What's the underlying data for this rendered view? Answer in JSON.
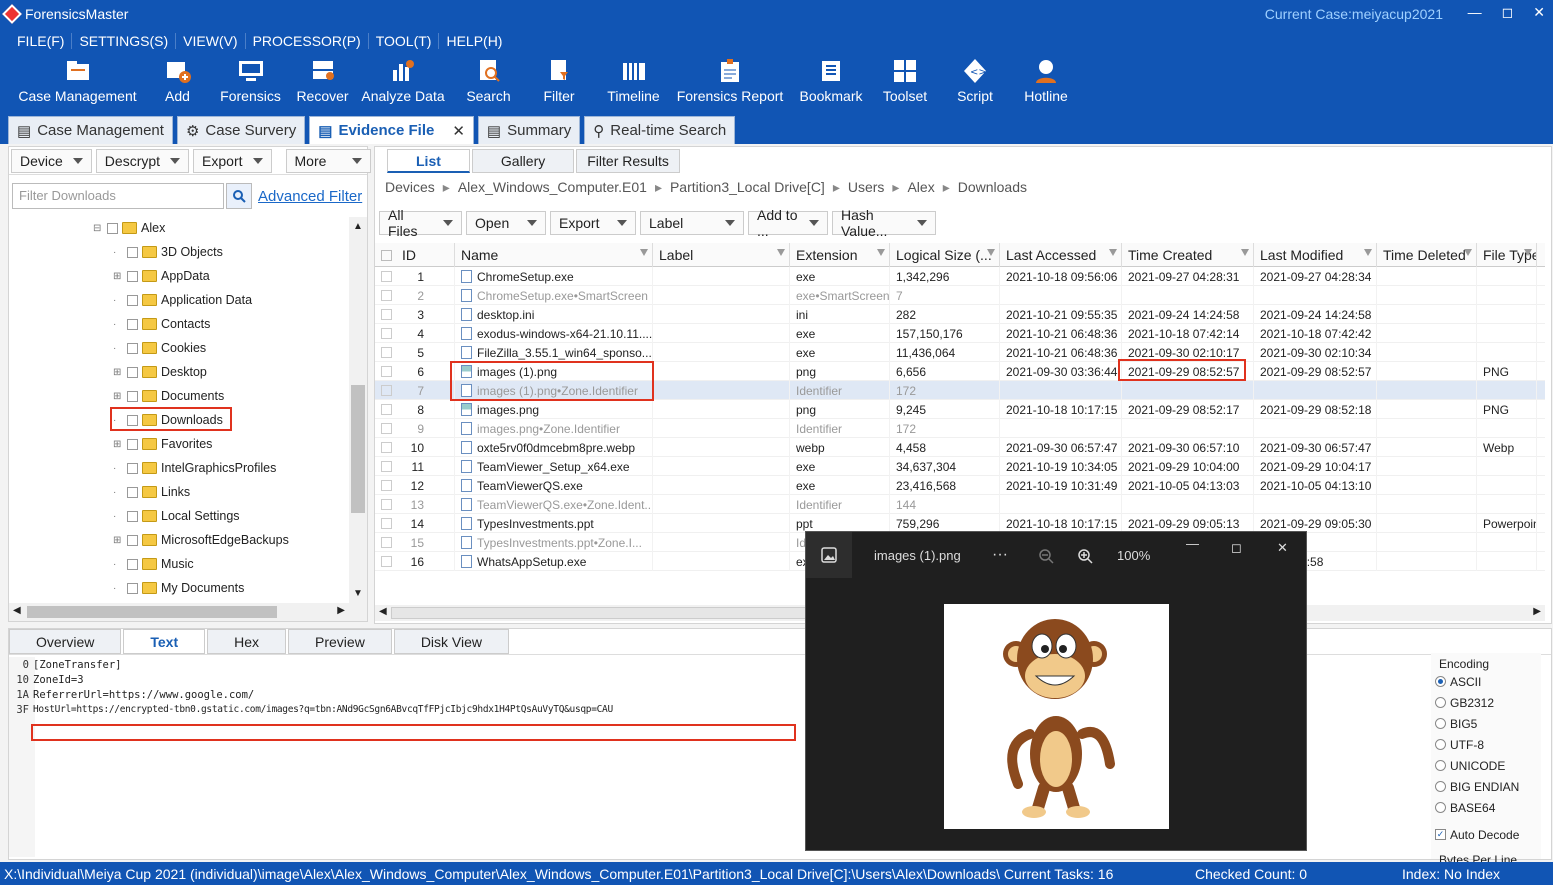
{
  "app": {
    "title": "ForensicsMaster",
    "current_case": "Current Case:meiyacup2021"
  },
  "menu": [
    "FILE(F)",
    "SETTINGS(S)",
    "VIEW(V)",
    "PROCESSOR(P)",
    "TOOL(T)",
    "HELP(H)"
  ],
  "toolbar": [
    {
      "label": "Case Management",
      "icon": "case-management-icon"
    },
    {
      "label": "Add",
      "icon": "add-icon"
    },
    {
      "label": "Forensics",
      "icon": "forensics-icon"
    },
    {
      "label": "Recover",
      "icon": "recover-icon"
    },
    {
      "label": "Analyze Data",
      "icon": "analyze-icon"
    },
    {
      "label": "Search",
      "icon": "search-icon"
    },
    {
      "label": "Filter",
      "icon": "filter-icon"
    },
    {
      "label": "Timeline",
      "icon": "timeline-icon"
    },
    {
      "label": "Forensics Report",
      "icon": "report-icon"
    },
    {
      "label": "Bookmark",
      "icon": "bookmark-icon"
    },
    {
      "label": "Toolset",
      "icon": "toolset-icon"
    },
    {
      "label": "Script",
      "icon": "script-icon"
    },
    {
      "label": "Hotline",
      "icon": "hotline-icon"
    }
  ],
  "doc_tabs": [
    "Case Management",
    "Case Survery",
    "Evidence File",
    "Summary",
    "Real-time Search"
  ],
  "left": {
    "dropdowns": [
      "Device",
      "Descrypt",
      "Export",
      "More"
    ],
    "filter_placeholder": "Filter Downloads",
    "advanced_filter": "Advanced Filter",
    "tree": [
      "Alex",
      "3D Objects",
      "AppData",
      "Application Data",
      "Contacts",
      "Cookies",
      "Desktop",
      "Documents",
      "Downloads",
      "Favorites",
      "IntelGraphicsProfiles",
      "Links",
      "Local Settings",
      "MicrosoftEdgeBackups",
      "Music",
      "My Documents"
    ]
  },
  "right": {
    "view_tabs": [
      "List",
      "Gallery",
      "Filter Results"
    ],
    "breadcrumb": [
      "Devices",
      "Alex_Windows_Computer.E01",
      "Partition3_Local Drive[C]",
      "Users",
      "Alex",
      "Downloads"
    ],
    "actions": [
      "All Files",
      "Open",
      "Export",
      "Label",
      "Add to ...",
      "Hash Value..."
    ],
    "columns": [
      "ID",
      "Name",
      "Label",
      "Extension",
      "Logical Size (...",
      "Last Accessed",
      "Time Created",
      "Last Modified",
      "Time Deleted",
      "File Type"
    ],
    "rows": [
      [
        "1",
        "ChromeSetup.exe",
        "",
        "exe",
        "1,342,296",
        "2021-10-18 09:56:06",
        "2021-09-27 04:28:31",
        "2021-09-27 04:28:34",
        "",
        ""
      ],
      [
        "2",
        "ChromeSetup.exe•SmartScreen",
        "",
        "exe•SmartScreen",
        "7",
        "",
        "",
        "",
        "",
        ""
      ],
      [
        "3",
        "desktop.ini",
        "",
        "ini",
        "282",
        "2021-10-21 09:55:35",
        "2021-09-24 14:24:58",
        "2021-09-24 14:24:58",
        "",
        ""
      ],
      [
        "4",
        "exodus-windows-x64-21.10.11....",
        "",
        "exe",
        "157,150,176",
        "2021-10-21 06:48:36",
        "2021-10-18 07:42:14",
        "2021-10-18 07:42:42",
        "",
        ""
      ],
      [
        "5",
        "FileZilla_3.55.1_win64_sponso...",
        "",
        "exe",
        "11,436,064",
        "2021-10-21 06:48:36",
        "2021-09-30 02:10:17",
        "2021-09-30 02:10:34",
        "",
        ""
      ],
      [
        "6",
        "images (1).png",
        "",
        "png",
        "6,656",
        "2021-09-30 03:36:44",
        "2021-09-29 08:52:57",
        "2021-09-29 08:52:57",
        "",
        "PNG"
      ],
      [
        "7",
        "images (1).png•Zone.Identifier",
        "",
        "Identifier",
        "172",
        "",
        "",
        "",
        "",
        ""
      ],
      [
        "8",
        "images.png",
        "",
        "png",
        "9,245",
        "2021-10-18 10:17:15",
        "2021-09-29 08:52:17",
        "2021-09-29 08:52:18",
        "",
        "PNG"
      ],
      [
        "9",
        "images.png•Zone.Identifier",
        "",
        "Identifier",
        "172",
        "",
        "",
        "",
        "",
        ""
      ],
      [
        "10",
        "oxte5rv0f0dmcebm8pre.webp",
        "",
        "webp",
        "4,458",
        "2021-09-30 06:57:47",
        "2021-09-30 06:57:10",
        "2021-09-30 06:57:47",
        "",
        "Webp"
      ],
      [
        "11",
        "TeamViewer_Setup_x64.exe",
        "",
        "exe",
        "34,637,304",
        "2021-10-19 10:34:05",
        "2021-09-29 10:04:00",
        "2021-09-29 10:04:17",
        "",
        ""
      ],
      [
        "12",
        "TeamViewerQS.exe",
        "",
        "exe",
        "23,416,568",
        "2021-10-19 10:31:49",
        "2021-10-05 04:13:03",
        "2021-10-05 04:13:10",
        "",
        ""
      ],
      [
        "13",
        "TeamViewerQS.exe•Zone.Ident...",
        "",
        "Identifier",
        "144",
        "",
        "",
        "",
        "",
        ""
      ],
      [
        "14",
        "TypesInvestments.ppt",
        "",
        "ppt",
        "759,296",
        "2021-10-18 10:17:15",
        "2021-09-29 09:05:13",
        "2021-09-29 09:05:30",
        "",
        "Powerpoint"
      ],
      [
        "15",
        "TypesInvestments.ppt•Zone.I...",
        "",
        "Id",
        "",
        "",
        "",
        "",
        "",
        ""
      ],
      [
        "16",
        "WhatsAppSetup.exe",
        "",
        "ex",
        "",
        "",
        "",
        "29 08:48:58",
        "",
        ""
      ]
    ]
  },
  "bottom": {
    "tabs": [
      "Overview",
      "Text",
      "Hex",
      "Preview",
      "Disk View"
    ],
    "lines": [
      {
        "off": "0",
        "text": "[ZoneTransfer]"
      },
      {
        "off": "10",
        "text": "ZoneId=3"
      },
      {
        "off": "1A",
        "text": "ReferrerUrl=https://www.google.com/"
      },
      {
        "off": "3F",
        "text": "HostUrl=https://encrypted-tbn0.gstatic.com/images?q=tbn:ANd9GcSgn6ABvcqTfFPjcIbjc9hdx1H4PtQsAuVyTQ&usqp=CAU"
      }
    ],
    "encoding_title": "Encoding",
    "encodings": [
      "ASCII",
      "GB2312",
      "BIG5",
      "UTF-8",
      "UNICODE",
      "BIG ENDIAN",
      "BASE64"
    ],
    "auto_decode": "Auto Decode",
    "bytes_per_line": "Bytes Per Line"
  },
  "status": {
    "path": "X:\\Individual\\Meiya Cup 2021 (individual)\\image\\Alex\\Alex_Windows_Computer\\Alex_Windows_Computer.E01\\Partition3_Local Drive[C]:\\Users\\Alex\\Downloads\\ Current Tasks: 16",
    "checked": "Checked Count: 0",
    "index": "Index: No Index"
  },
  "viewer": {
    "filename": "images (1).png",
    "dots": "···",
    "zoom": "100%"
  }
}
